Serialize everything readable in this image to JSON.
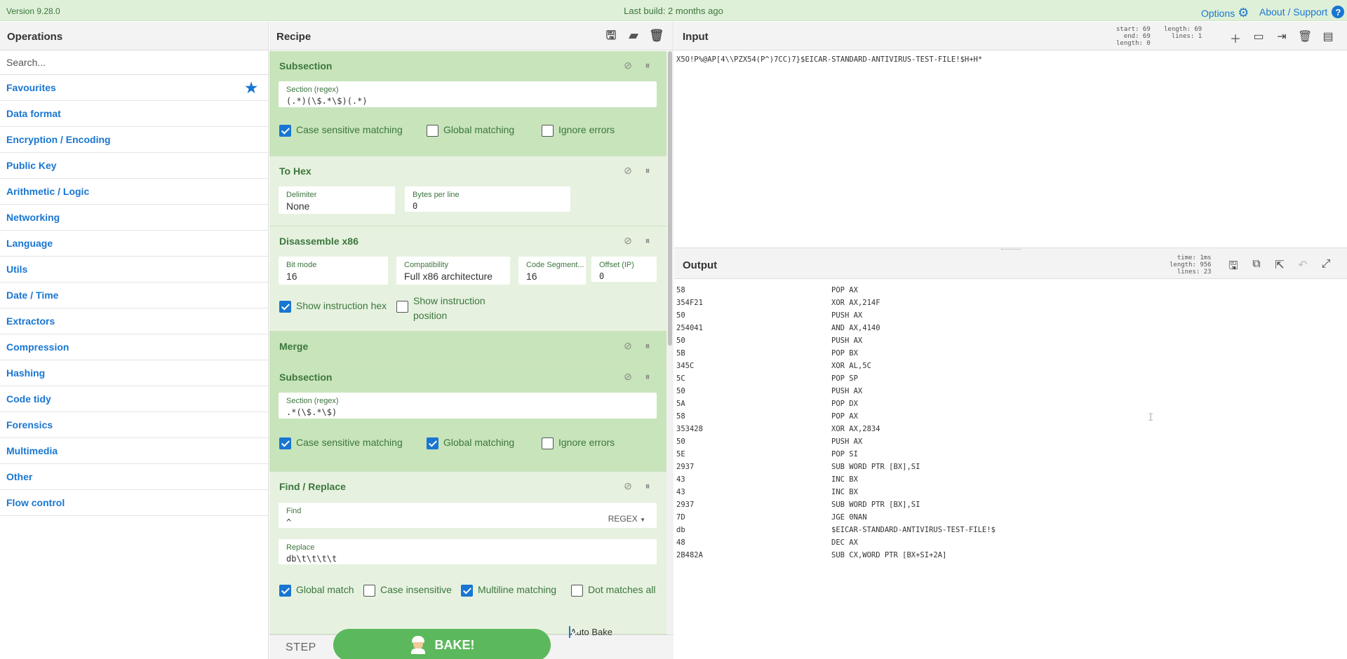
{
  "banner": {
    "version": "Version 9.28.0",
    "build": "Last build: 2 months ago",
    "options": "Options",
    "about": "About / Support"
  },
  "operations": {
    "title": "Operations",
    "search_placeholder": "Search...",
    "categories": [
      "Favourites",
      "Data format",
      "Encryption / Encoding",
      "Public Key",
      "Arithmetic / Logic",
      "Networking",
      "Language",
      "Utils",
      "Date / Time",
      "Extractors",
      "Compression",
      "Hashing",
      "Code tidy",
      "Forensics",
      "Multimedia",
      "Other",
      "Flow control"
    ]
  },
  "recipe": {
    "title": "Recipe",
    "ops": {
      "subsection1": {
        "title": "Subsection",
        "section_label": "Section (regex)",
        "section_value": "(.*)(\\$.*\\$)(.*)",
        "case_sensitive": "Case sensitive matching",
        "global": "Global matching",
        "ignore_errors": "Ignore errors"
      },
      "to_hex": {
        "title": "To Hex",
        "delimiter_label": "Delimiter",
        "delimiter_value": "None",
        "bytes_label": "Bytes per line",
        "bytes_value": "0"
      },
      "disassemble": {
        "title": "Disassemble x86",
        "bit_mode_label": "Bit mode",
        "bit_mode_value": "16",
        "compat_label": "Compatibility",
        "compat_value": "Full x86 architecture",
        "code_seg_label": "Code Segment...",
        "code_seg_value": "16",
        "offset_label": "Offset (IP)",
        "offset_value": "0",
        "show_hex": "Show instruction hex",
        "show_pos_1": "Show instruction",
        "show_pos_2": "position"
      },
      "merge": {
        "title": "Merge"
      },
      "subsection2": {
        "title": "Subsection",
        "section_label": "Section (regex)",
        "section_value": ".*(\\$.*\\$)",
        "case_sensitive": "Case sensitive matching",
        "global": "Global matching",
        "ignore_errors": "Ignore errors"
      },
      "find_replace": {
        "title": "Find / Replace",
        "find_label": "Find",
        "find_value": "^",
        "find_mode": "REGEX",
        "replace_label": "Replace",
        "replace_value": "db\\t\\t\\t\\t",
        "global_match": "Global match",
        "case_insensitive": "Case insensitive",
        "multiline": "Multiline matching",
        "dot_all": "Dot matches all"
      }
    },
    "step": "STEP",
    "bake": "BAKE!",
    "auto_bake": "Auto Bake"
  },
  "input": {
    "title": "Input",
    "stats_left": [
      "start: 69",
      "end: 69",
      "length: 0"
    ],
    "stats_right": [
      "length: 69",
      "lines: 1"
    ],
    "text": "X5O!P%@AP[4\\\\PZX54(P^)7CC)7}$EICAR-STANDARD-ANTIVIRUS-TEST-FILE!$H+H*"
  },
  "output": {
    "title": "Output",
    "stats": [
      "time: 1ms",
      "length: 956",
      "lines: 23"
    ],
    "lines": [
      {
        "hex": "58",
        "ins": "POP AX"
      },
      {
        "hex": "354F21",
        "ins": "XOR AX,214F"
      },
      {
        "hex": "50",
        "ins": "PUSH AX"
      },
      {
        "hex": "254041",
        "ins": "AND AX,4140"
      },
      {
        "hex": "50",
        "ins": "PUSH AX"
      },
      {
        "hex": "5B",
        "ins": "POP BX"
      },
      {
        "hex": "345C",
        "ins": "XOR AL,5C"
      },
      {
        "hex": "5C",
        "ins": "POP SP"
      },
      {
        "hex": "50",
        "ins": "PUSH AX"
      },
      {
        "hex": "5A",
        "ins": "POP DX"
      },
      {
        "hex": "58",
        "ins": "POP AX"
      },
      {
        "hex": "353428",
        "ins": "XOR AX,2834"
      },
      {
        "hex": "50",
        "ins": "PUSH AX"
      },
      {
        "hex": "5E",
        "ins": "POP SI"
      },
      {
        "hex": "2937",
        "ins": "SUB WORD PTR [BX],SI"
      },
      {
        "hex": "43",
        "ins": "INC BX"
      },
      {
        "hex": "43",
        "ins": "INC BX"
      },
      {
        "hex": "2937",
        "ins": "SUB WORD PTR [BX],SI"
      },
      {
        "hex": "7D",
        "ins": "JGE 0NAN"
      },
      {
        "hex": "db",
        "ins": "$EICAR-STANDARD-ANTIVIRUS-TEST-FILE!$"
      },
      {
        "hex": "48",
        "ins": "DEC AX"
      },
      {
        "hex": "2B482A",
        "ins": "SUB CX,WORD PTR [BX+SI+2A]"
      }
    ]
  },
  "icons": {
    "gear": "⚙",
    "star": "★",
    "save": "💾",
    "folder": "📁",
    "trash": "🗑",
    "disable": "⊘",
    "pause": "⏸",
    "plus": "+",
    "help": "?"
  },
  "colors": {
    "accent": "#1976d2",
    "bake_green": "#5cb85c",
    "op_bg": "#c7e4ba",
    "op_bg_light": "#e6f2df",
    "banner_bg": "#dff0d8",
    "label_green": "#3c763d"
  }
}
